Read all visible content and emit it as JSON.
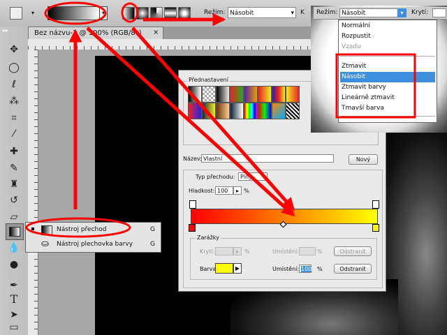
{
  "options_bar": {
    "mode_label": "Režim:",
    "mode_value": "Násobit",
    "opacity_label_partial": "K"
  },
  "document_tab": {
    "title": "Bez názvu-1 @ 100% (RGB/8*)",
    "close": "×"
  },
  "toolbox": {
    "expand": "▸▸"
  },
  "flyout": {
    "items": [
      {
        "label": "Nástroj přechod",
        "shortcut": "G"
      },
      {
        "label": "Nástroj plechovka barvy",
        "shortcut": "G"
      }
    ]
  },
  "gradient_editor": {
    "presets_label": "Přednastavení",
    "name_label": "Název:",
    "name_value": "Vlastní",
    "new_button": "Nový",
    "type_label": "Typ přechodu:",
    "type_value": "Plný",
    "smoothness_label": "Hladkost:",
    "smoothness_value": "100",
    "smoothness_unit": "%",
    "stops_label": "Zarážky",
    "opacity_label": "Krytí:",
    "opacity_unit": "%",
    "location_label": "Umístění:",
    "location_unit": "%",
    "delete_button": "Odstranit",
    "color_label": "Barva:",
    "color_location_label": "Umístění:",
    "color_location_value": "100",
    "color_location_unit": "%",
    "delete_button2": "Odstranit",
    "gradient_start_color": "#ff0000",
    "gradient_end_color": "#ffff00",
    "stop_color": "#ffff00"
  },
  "mode_dropdown": {
    "header_label": "Režim:",
    "header_value": "Násobit",
    "opacity_label": "Krytí:",
    "items": [
      {
        "label": "Normální",
        "state": "normal"
      },
      {
        "label": "Rozpustit",
        "state": "normal"
      },
      {
        "label": "Vzadu",
        "state": "disabled"
      },
      {
        "label": "Ztmavit",
        "state": "normal"
      },
      {
        "label": "Násobit",
        "state": "selected"
      },
      {
        "label": "Ztmavit barvy",
        "state": "normal"
      },
      {
        "label": "Lineárně ztmavit",
        "state": "normal"
      },
      {
        "label": "Tmavší barva",
        "state": "normal"
      }
    ]
  },
  "annotation_color": "#ff0000",
  "highlight_color": "#3e8fe0"
}
